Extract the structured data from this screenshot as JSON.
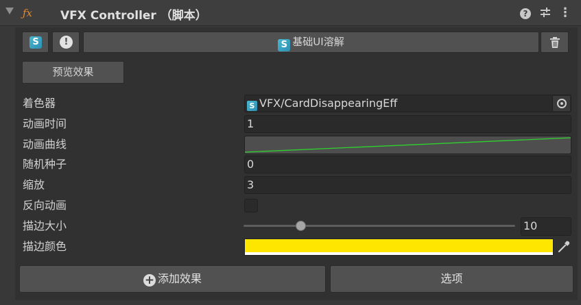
{
  "header": {
    "title": "VFX Controller （脚本）",
    "icons": [
      "fold-arrow-icon",
      "script-icon",
      "help-icon",
      "preset-icon",
      "more-icon"
    ],
    "script_icon_glyph": "ƒx",
    "help_glyph": "?",
    "more_glyph": "⋮"
  },
  "effect": {
    "name": "基础UI溶解",
    "icon_letter": "S",
    "info_glyph": "!"
  },
  "preview_button": "预览效果",
  "fields": {
    "shader": {
      "label": "着色器",
      "value": "VFX/CardDisappearingEff"
    },
    "duration": {
      "label": "动画时间",
      "value": "1"
    },
    "curve": {
      "label": "动画曲线",
      "curve_color": "#2fd32f"
    },
    "seed": {
      "label": "随机种子",
      "value": "0"
    },
    "scale": {
      "label": "缩放",
      "value": "3"
    },
    "reverse": {
      "label": "反向动画",
      "checked": false
    },
    "outline_size": {
      "label": "描边大小",
      "value": "10",
      "fraction": 0.21
    },
    "outline_color": {
      "label": "描边颜色",
      "color": "#ffe600",
      "alpha_color": "#ffffff"
    }
  },
  "buttons": {
    "add_effect": "添加效果",
    "add_effect_glyph": "+",
    "options": "选项"
  },
  "colors": {
    "accent_s_icon": "#3aa9c8",
    "outline_yellow": "#ffe600",
    "curve_green": "#2fd32f"
  }
}
